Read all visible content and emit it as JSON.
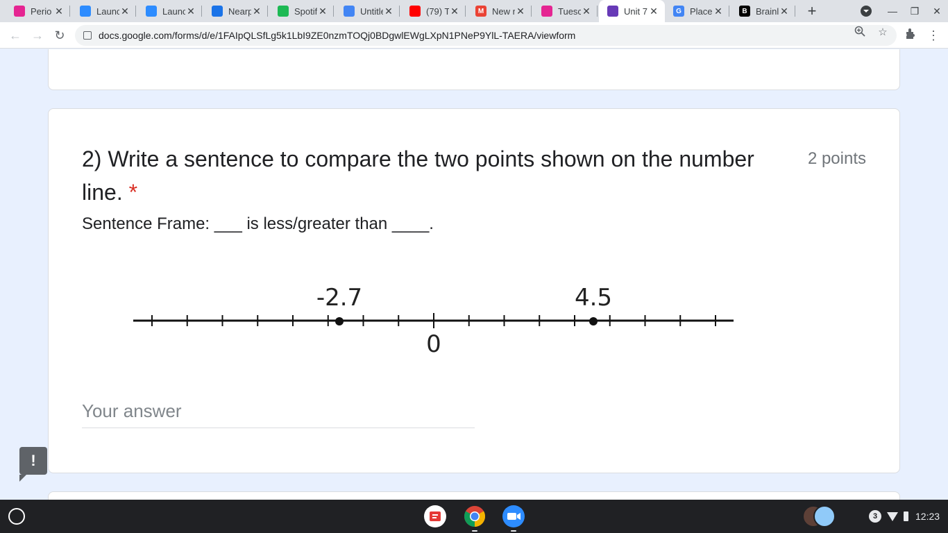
{
  "browser": {
    "tabs": [
      {
        "title": "Perio",
        "icon": "classroom-icon",
        "color": "#e52592",
        "glyph": ""
      },
      {
        "title": "Launc",
        "icon": "zoom-icon",
        "color": "#2d8cff",
        "glyph": ""
      },
      {
        "title": "Launc",
        "icon": "zoom-icon",
        "color": "#2d8cff",
        "glyph": ""
      },
      {
        "title": "Nearp",
        "icon": "nearpod-icon",
        "color": "#1a73e8",
        "glyph": ""
      },
      {
        "title": "Spotif",
        "icon": "spotify-icon",
        "color": "#1db954",
        "glyph": ""
      },
      {
        "title": "Untitle",
        "icon": "docs-icon",
        "color": "#4285f4",
        "glyph": ""
      },
      {
        "title": "(79) T",
        "icon": "youtube-icon",
        "color": "#ff0000",
        "glyph": ""
      },
      {
        "title": "New r",
        "icon": "gmail-icon",
        "color": "#ea4335",
        "glyph": "M"
      },
      {
        "title": "Tuesc",
        "icon": "classroom-icon",
        "color": "#e52592",
        "glyph": ""
      },
      {
        "title": "Unit 7",
        "icon": "forms-icon",
        "color": "#673ab7",
        "glyph": "",
        "active": true
      },
      {
        "title": "Place",
        "icon": "google-icon",
        "color": "#4285f4",
        "glyph": "G"
      },
      {
        "title": "Brainl",
        "icon": "brainly-icon",
        "color": "#000000",
        "glyph": "B"
      }
    ],
    "url": "docs.google.com/forms/d/e/1FAIpQLSfLg5k1LbI9ZE0nzmTOQj0BDgwlEWgLXpN1PNeP9YlL-TAERA/viewform"
  },
  "question": {
    "number_title": "2) Write a sentence to compare the two points shown on the number line.",
    "required_marker": "*",
    "points": "2 points",
    "description": "Sentence Frame: ___ is less/greater than ____.",
    "number_line": {
      "min": -4,
      "max": 4,
      "tick_step": 0.5,
      "zero_label": "0",
      "points": [
        {
          "value": -2.7,
          "label": "-2.7"
        },
        {
          "value": 4.5,
          "label": "4.5"
        }
      ]
    },
    "answer_placeholder": "Your answer"
  },
  "shelf": {
    "notification_count": "3",
    "time": "12:23"
  }
}
